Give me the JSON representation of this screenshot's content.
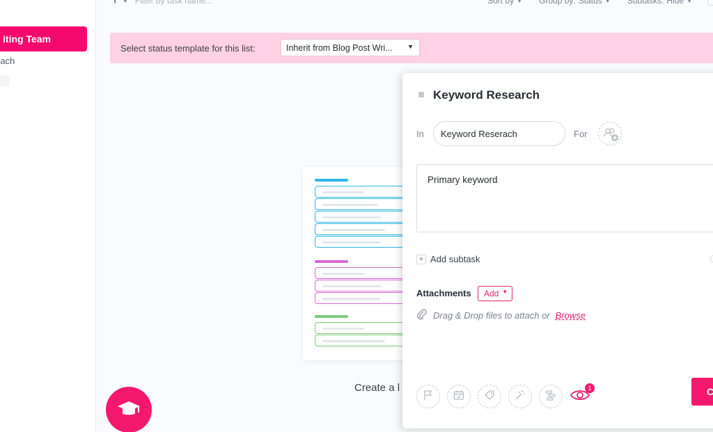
{
  "sidebar": {
    "active_item": "iting Team",
    "item": "rach"
  },
  "toolbar": {
    "filter_placeholder": "Filter by task name...",
    "sort_label": "Sort by",
    "group_label": "Group by:",
    "group_value": "Status",
    "subtasks_label": "Subtasks:",
    "subtasks_value": "Hide"
  },
  "banner": {
    "label": "Select status template for this list:",
    "select_value": "Inherit from Blog Post Wri..."
  },
  "empty_state": {
    "create_text": "Create a l",
    "accent_colors": [
      "#2bb6e8",
      "#d86ad6",
      "#7ccb7c"
    ]
  },
  "task": {
    "title": "Keyword Research",
    "in_label": "In",
    "list_name": "Keyword Reserach",
    "for_label": "For",
    "description": "Primary keyword",
    "add_subtask": "Add subtask",
    "attachments_title": "Attachments",
    "add_button": "Add",
    "drop_text": "Drag & Drop files to attach or",
    "browse_link": "Browse",
    "watchers_count": "1",
    "create_button": "C"
  },
  "colors": {
    "brand_pink": "#f5186f",
    "banner_bg": "#ffd1e3"
  }
}
